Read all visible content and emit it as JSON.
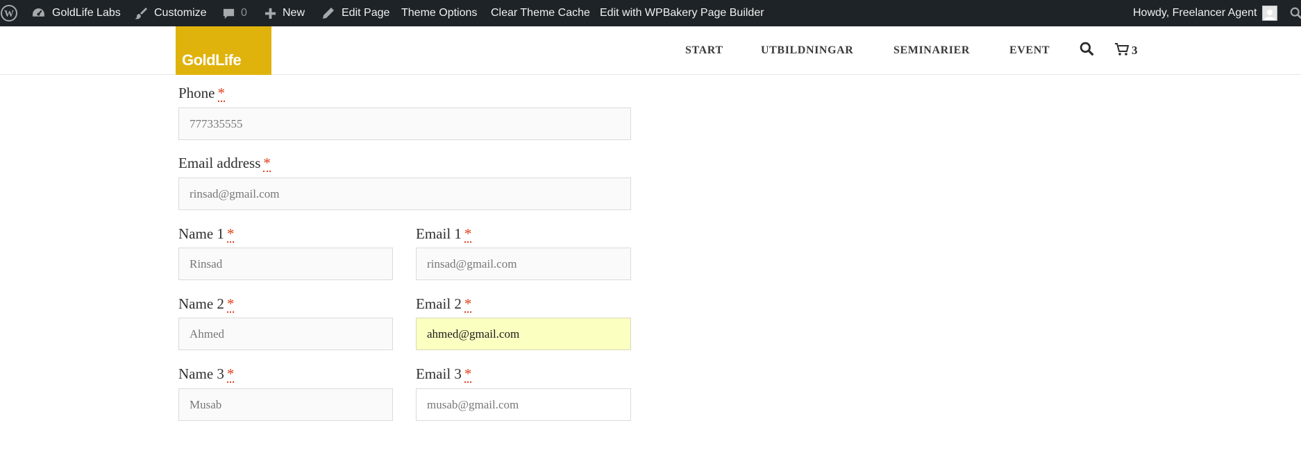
{
  "admin_bar": {
    "site_name": "GoldLife Labs",
    "customize": "Customize",
    "comments_count": "0",
    "new": "New",
    "edit_page": "Edit Page",
    "theme_options": "Theme Options",
    "clear_cache": "Clear Theme Cache",
    "wpbakery": "Edit with WPBakery Page Builder",
    "howdy": "Howdy, Freelancer Agent"
  },
  "header": {
    "logo_text": "GoldLife",
    "nav": [
      "START",
      "UTBILDNINGAR",
      "SEMINARIER",
      "EVENT"
    ],
    "cart_count": "3"
  },
  "form": {
    "required_marker": "*",
    "phone": {
      "label": "Phone",
      "value": "777335555"
    },
    "email": {
      "label": "Email address",
      "value": "rinsad@gmail.com"
    },
    "attendees": [
      {
        "name_label": "Name 1",
        "name_value": "Rinsad",
        "email_label": "Email 1",
        "email_value": "rinsad@gmail.com"
      },
      {
        "name_label": "Name 2",
        "name_value": "Ahmed",
        "email_label": "Email 2",
        "email_value": "ahmed@gmail.com"
      },
      {
        "name_label": "Name 3",
        "name_value": "Musab",
        "email_label": "Email 3",
        "email_value": "musab@gmail.com"
      }
    ]
  },
  "colors": {
    "admin_bar_bg": "#1d2327",
    "logo_bg": "#e0b30c",
    "required": "#e2401c",
    "autofill_highlight": "#fbffc0"
  },
  "icons": [
    "wordpress-icon",
    "dashboard-icon",
    "brush-icon",
    "comment-icon",
    "plus-icon",
    "pencil-icon",
    "search-icon",
    "cart-icon"
  ]
}
